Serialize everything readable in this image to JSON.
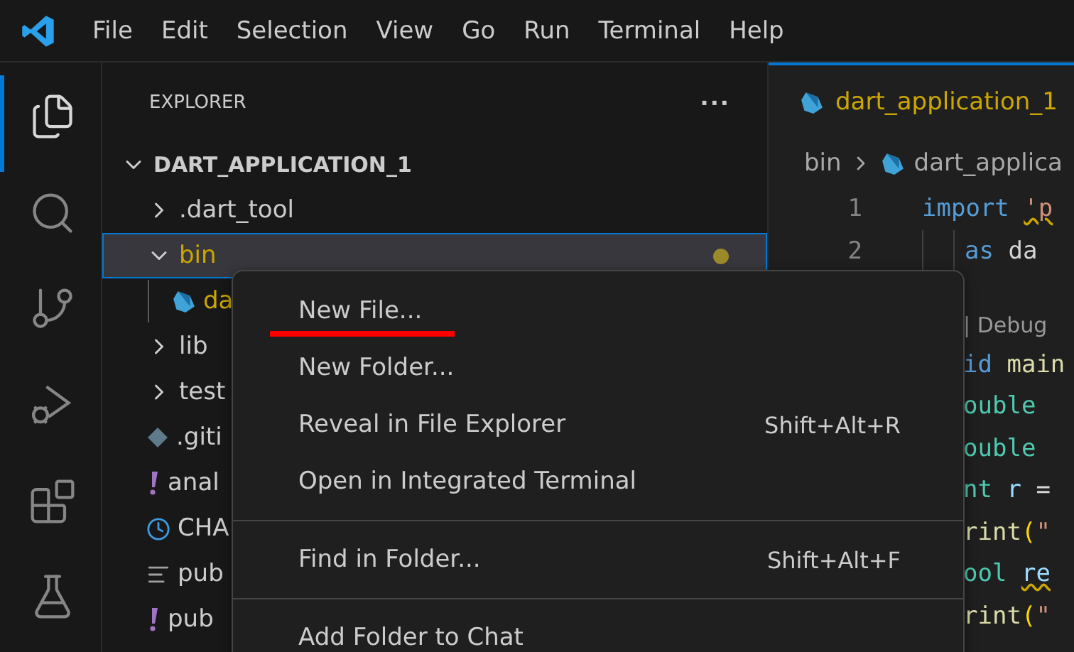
{
  "menu_bar": [
    "File",
    "Edit",
    "Selection",
    "View",
    "Go",
    "Run",
    "Terminal",
    "Help"
  ],
  "activity_bar": [
    {
      "kind": "explorer",
      "selected": true
    },
    {
      "kind": "search",
      "selected": false
    },
    {
      "kind": "scm",
      "selected": false
    },
    {
      "kind": "debug",
      "selected": false
    },
    {
      "kind": "extensions",
      "selected": false
    },
    {
      "kind": "testing",
      "selected": false
    }
  ],
  "sidebar": {
    "title": "EXPLORER",
    "more": "···",
    "project": {
      "label": "DART_APPLICATION_1",
      "expanded": true
    },
    "items": [
      {
        "label": ".dart_tool",
        "kind": "folder",
        "expanded": false,
        "selected": false,
        "modified": false
      },
      {
        "label": "bin",
        "kind": "folder",
        "expanded": true,
        "selected": true,
        "modified": true,
        "children": [
          {
            "label": "da",
            "kind": "dart",
            "selected": false,
            "modified": true
          }
        ]
      },
      {
        "label": "lib",
        "kind": "folder",
        "expanded": false,
        "selected": false,
        "modified": false
      },
      {
        "label": "test",
        "kind": "folder",
        "expanded": false,
        "selected": false,
        "modified": false
      },
      {
        "label": ".giti",
        "kind": "git",
        "selected": false,
        "modified": false
      },
      {
        "label": "anal",
        "kind": "yaml",
        "selected": false,
        "modified": false
      },
      {
        "label": "CHA",
        "kind": "changelog",
        "selected": false,
        "modified": false
      },
      {
        "label": "pub",
        "kind": "lock",
        "selected": false,
        "modified": false
      },
      {
        "label": "pub",
        "kind": "yaml",
        "selected": false,
        "modified": false
      }
    ]
  },
  "editor": {
    "tab": {
      "label": "dart_application_1",
      "selected": true
    },
    "breadcrumb": [
      "bin",
      "dart_applica"
    ],
    "lines": [
      {
        "number": "1",
        "tokens": [
          {
            "text": "import",
            "kind": "keyword"
          },
          {
            "text": "'p",
            "kind": "string",
            "warning": true,
            "spaced": true
          }
        ]
      },
      {
        "number": "2",
        "tokens": [
          {
            "text": "as",
            "kind": "keyword"
          },
          {
            "text": "da",
            "kind": "plain",
            "spaced": true
          }
        ]
      }
    ],
    "covered_lines": [
      {
        "tokens": [
          {
            "text": "| Debug",
            "kind": "codelens"
          }
        ]
      },
      {
        "tokens": [
          {
            "text": "id",
            "kind": "keyword"
          },
          {
            "text": "main",
            "kind": "func",
            "spaced": true
          }
        ]
      },
      {
        "tokens": [
          {
            "text": "ouble",
            "kind": "type"
          }
        ]
      },
      {
        "tokens": [
          {
            "text": "ouble",
            "kind": "type"
          }
        ]
      },
      {
        "tokens": [
          {
            "text": "nt",
            "kind": "type"
          },
          {
            "text": "r",
            "kind": "var",
            "spaced": true
          },
          {
            "text": "=",
            "kind": "plain",
            "spaced": true
          }
        ]
      },
      {
        "tokens": [
          {
            "text": "rint",
            "kind": "func"
          },
          {
            "text": "(",
            "kind": "bracket"
          },
          {
            "text": "\"",
            "kind": "string"
          }
        ]
      },
      {
        "tokens": [
          {
            "text": "ool",
            "kind": "type"
          },
          {
            "text": "re",
            "kind": "var",
            "warning": true,
            "spaced": true
          }
        ]
      },
      {
        "tokens": [
          {
            "text": "rint",
            "kind": "func"
          },
          {
            "text": "(",
            "kind": "bracket"
          },
          {
            "text": "\"",
            "kind": "string"
          }
        ]
      }
    ]
  },
  "context_menu": {
    "groups": [
      [
        {
          "label": "New File...",
          "underlined": true
        },
        {
          "label": "New Folder..."
        },
        {
          "label": "Reveal in File Explorer",
          "shortcut": "Shift+Alt+R"
        },
        {
          "label": "Open in Integrated Terminal"
        }
      ],
      [
        {
          "label": "Find in Folder...",
          "shortcut": "Shift+Alt+F"
        }
      ],
      [
        {
          "label": "Add Folder to Chat"
        }
      ]
    ]
  }
}
